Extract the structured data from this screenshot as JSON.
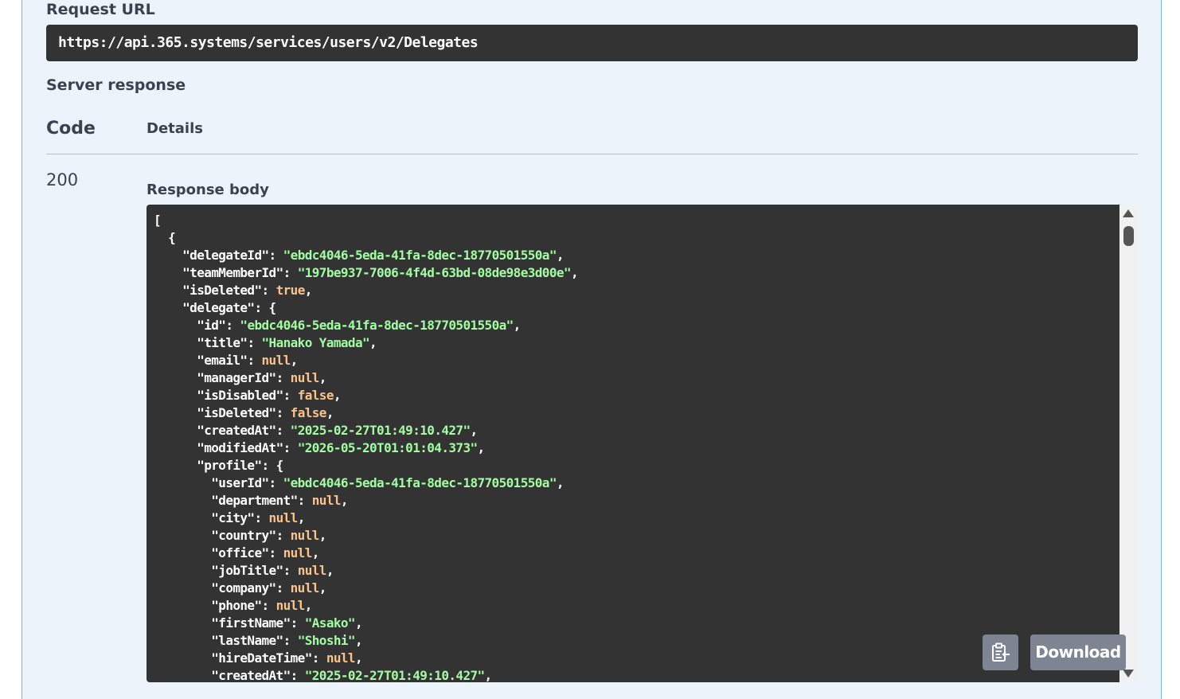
{
  "request_url": {
    "label": "Request URL",
    "value": "https://api.365.systems/services/users/v2/Delegates"
  },
  "server_response": {
    "label": "Server response",
    "columns": {
      "code": "Code",
      "details": "Details"
    },
    "status_code": "200",
    "body_label": "Response body"
  },
  "response_body": [
    [
      [
        "p",
        "["
      ]
    ],
    [
      [
        "p",
        "  {"
      ]
    ],
    [
      [
        "p",
        "    "
      ],
      [
        "k",
        "\"delegateId\""
      ],
      [
        "p",
        ": "
      ],
      [
        "s",
        "\"ebdc4046-5eda-41fa-8dec-18770501550a\""
      ],
      [
        "p",
        ","
      ]
    ],
    [
      [
        "p",
        "    "
      ],
      [
        "k",
        "\"teamMemberId\""
      ],
      [
        "p",
        ": "
      ],
      [
        "s",
        "\"197be937-7006-4f4d-63bd-08de98e3d00e\""
      ],
      [
        "p",
        ","
      ]
    ],
    [
      [
        "p",
        "    "
      ],
      [
        "k",
        "\"isDeleted\""
      ],
      [
        "p",
        ": "
      ],
      [
        "n",
        "true"
      ],
      [
        "p",
        ","
      ]
    ],
    [
      [
        "p",
        "    "
      ],
      [
        "k",
        "\"delegate\""
      ],
      [
        "p",
        ": {"
      ]
    ],
    [
      [
        "p",
        "      "
      ],
      [
        "k",
        "\"id\""
      ],
      [
        "p",
        ": "
      ],
      [
        "s",
        "\"ebdc4046-5eda-41fa-8dec-18770501550a\""
      ],
      [
        "p",
        ","
      ]
    ],
    [
      [
        "p",
        "      "
      ],
      [
        "k",
        "\"title\""
      ],
      [
        "p",
        ": "
      ],
      [
        "s",
        "\"Hanako Yamada\""
      ],
      [
        "p",
        ","
      ]
    ],
    [
      [
        "p",
        "      "
      ],
      [
        "k",
        "\"email\""
      ],
      [
        "p",
        ": "
      ],
      [
        "n",
        "null"
      ],
      [
        "p",
        ","
      ]
    ],
    [
      [
        "p",
        "      "
      ],
      [
        "k",
        "\"managerId\""
      ],
      [
        "p",
        ": "
      ],
      [
        "n",
        "null"
      ],
      [
        "p",
        ","
      ]
    ],
    [
      [
        "p",
        "      "
      ],
      [
        "k",
        "\"isDisabled\""
      ],
      [
        "p",
        ": "
      ],
      [
        "n",
        "false"
      ],
      [
        "p",
        ","
      ]
    ],
    [
      [
        "p",
        "      "
      ],
      [
        "k",
        "\"isDeleted\""
      ],
      [
        "p",
        ": "
      ],
      [
        "n",
        "false"
      ],
      [
        "p",
        ","
      ]
    ],
    [
      [
        "p",
        "      "
      ],
      [
        "k",
        "\"createdAt\""
      ],
      [
        "p",
        ": "
      ],
      [
        "s",
        "\"2025-02-27T01:49:10.427\""
      ],
      [
        "p",
        ","
      ]
    ],
    [
      [
        "p",
        "      "
      ],
      [
        "k",
        "\"modifiedAt\""
      ],
      [
        "p",
        ": "
      ],
      [
        "s",
        "\"2026-05-20T01:01:04.373\""
      ],
      [
        "p",
        ","
      ]
    ],
    [
      [
        "p",
        "      "
      ],
      [
        "k",
        "\"profile\""
      ],
      [
        "p",
        ": {"
      ]
    ],
    [
      [
        "p",
        "        "
      ],
      [
        "k",
        "\"userId\""
      ],
      [
        "p",
        ": "
      ],
      [
        "s",
        "\"ebdc4046-5eda-41fa-8dec-18770501550a\""
      ],
      [
        "p",
        ","
      ]
    ],
    [
      [
        "p",
        "        "
      ],
      [
        "k",
        "\"department\""
      ],
      [
        "p",
        ": "
      ],
      [
        "n",
        "null"
      ],
      [
        "p",
        ","
      ]
    ],
    [
      [
        "p",
        "        "
      ],
      [
        "k",
        "\"city\""
      ],
      [
        "p",
        ": "
      ],
      [
        "n",
        "null"
      ],
      [
        "p",
        ","
      ]
    ],
    [
      [
        "p",
        "        "
      ],
      [
        "k",
        "\"country\""
      ],
      [
        "p",
        ": "
      ],
      [
        "n",
        "null"
      ],
      [
        "p",
        ","
      ]
    ],
    [
      [
        "p",
        "        "
      ],
      [
        "k",
        "\"office\""
      ],
      [
        "p",
        ": "
      ],
      [
        "n",
        "null"
      ],
      [
        "p",
        ","
      ]
    ],
    [
      [
        "p",
        "        "
      ],
      [
        "k",
        "\"jobTitle\""
      ],
      [
        "p",
        ": "
      ],
      [
        "n",
        "null"
      ],
      [
        "p",
        ","
      ]
    ],
    [
      [
        "p",
        "        "
      ],
      [
        "k",
        "\"company\""
      ],
      [
        "p",
        ": "
      ],
      [
        "n",
        "null"
      ],
      [
        "p",
        ","
      ]
    ],
    [
      [
        "p",
        "        "
      ],
      [
        "k",
        "\"phone\""
      ],
      [
        "p",
        ": "
      ],
      [
        "n",
        "null"
      ],
      [
        "p",
        ","
      ]
    ],
    [
      [
        "p",
        "        "
      ],
      [
        "k",
        "\"firstName\""
      ],
      [
        "p",
        ": "
      ],
      [
        "s",
        "\"Asako\""
      ],
      [
        "p",
        ","
      ]
    ],
    [
      [
        "p",
        "        "
      ],
      [
        "k",
        "\"lastName\""
      ],
      [
        "p",
        ": "
      ],
      [
        "s",
        "\"Shoshi\""
      ],
      [
        "p",
        ","
      ]
    ],
    [
      [
        "p",
        "        "
      ],
      [
        "k",
        "\"hireDateTime\""
      ],
      [
        "p",
        ": "
      ],
      [
        "n",
        "null"
      ],
      [
        "p",
        ","
      ]
    ],
    [
      [
        "p",
        "        "
      ],
      [
        "k",
        "\"createdAt\""
      ],
      [
        "p",
        ": "
      ],
      [
        "s",
        "\"2025-02-27T01:49:10.427\""
      ],
      [
        "p",
        ","
      ]
    ]
  ],
  "actions": {
    "copy_icon": "clipboard-copy-icon",
    "download_label": "Download"
  },
  "colors": {
    "panel_bg": "#ebf3fb",
    "code_bg": "#333333",
    "string": "#a2fca2",
    "literal": "#fcc28c",
    "button_bg": "#7d8492"
  }
}
